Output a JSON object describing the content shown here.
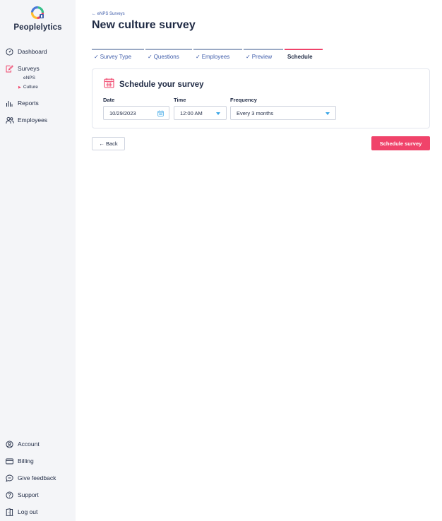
{
  "app": {
    "name": "Peoplelytics",
    "logo_icon": "peoplelytics-logo-icon"
  },
  "nav": {
    "dashboard": "Dashboard",
    "surveys": "Surveys",
    "surveys_sub": [
      "eNPS",
      "Culture"
    ],
    "reports": "Reports",
    "employees": "Employees",
    "account": "Account",
    "billing": "Billing",
    "feedback": "Give feedback",
    "support": "Support",
    "logout": "Log out"
  },
  "header": {
    "breadcrumb": "← eNPS Surveys",
    "title": "New culture survey"
  },
  "steps": [
    {
      "label": "Survey Type",
      "done": true
    },
    {
      "label": "Questions",
      "done": true
    },
    {
      "label": "Employees",
      "done": true
    },
    {
      "label": "Preview",
      "done": true
    },
    {
      "label": "Schedule",
      "done": false,
      "current": true
    }
  ],
  "schedule": {
    "title": "Schedule your survey",
    "date_label": "Date",
    "date_value": "10/29/2023",
    "time_label": "Time",
    "time_value": "12:00 AM",
    "frequency_label": "Frequency",
    "frequency_value": "Every 3 months"
  },
  "actions": {
    "back": "← Back",
    "schedule": "Schedule survey"
  },
  "colors": {
    "accent": "#f0436a",
    "link": "#3d5ba9",
    "select_caret": "#3aa6e6",
    "sidebar_bg": "#f4f5f8"
  }
}
